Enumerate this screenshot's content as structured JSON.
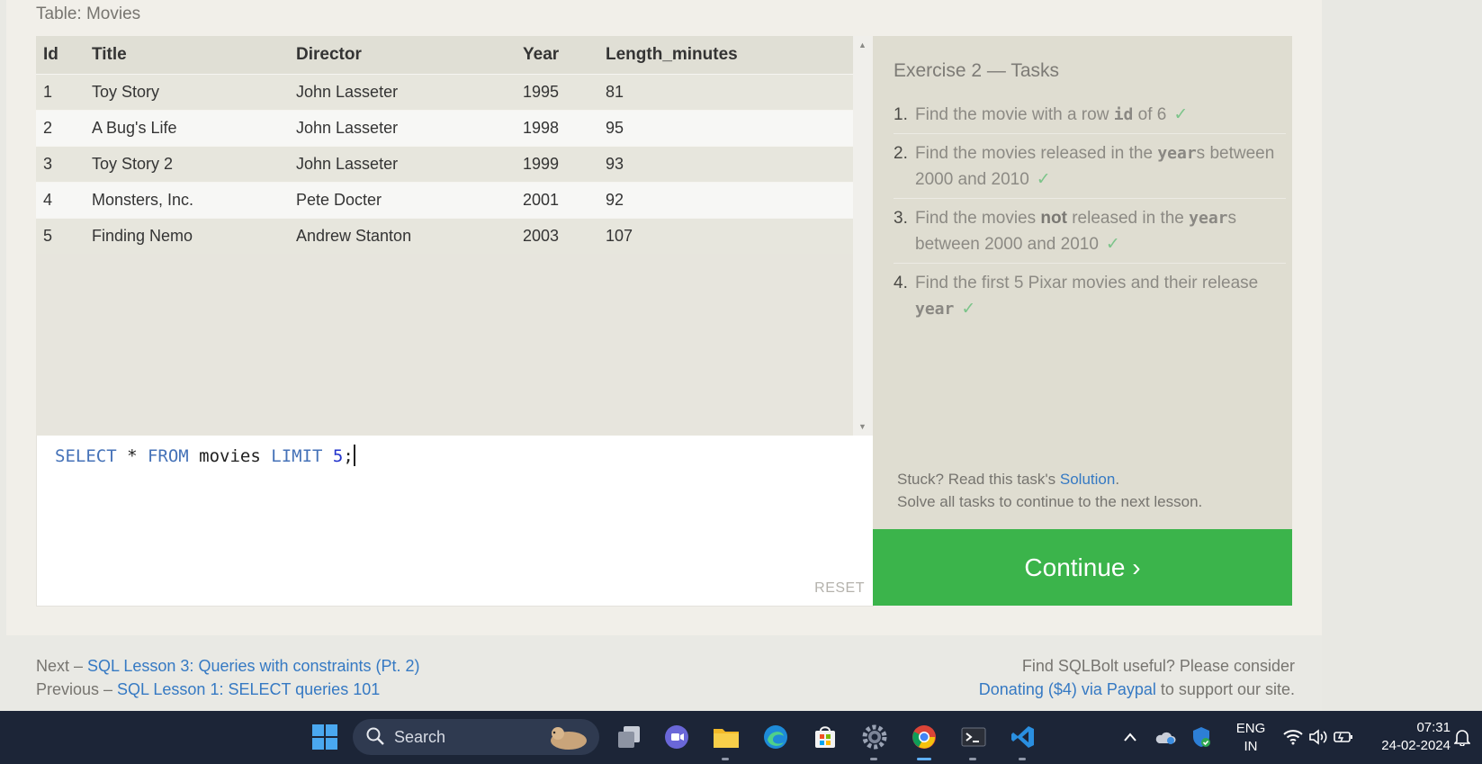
{
  "table_caption": "Table: Movies",
  "table": {
    "columns": [
      "Id",
      "Title",
      "Director",
      "Year",
      "Length_minutes"
    ],
    "rows": [
      [
        "1",
        "Toy Story",
        "John Lasseter",
        "1995",
        "81"
      ],
      [
        "2",
        "A Bug's Life",
        "John Lasseter",
        "1998",
        "95"
      ],
      [
        "3",
        "Toy Story 2",
        "John Lasseter",
        "1999",
        "93"
      ],
      [
        "4",
        "Monsters, Inc.",
        "Pete Docter",
        "2001",
        "92"
      ],
      [
        "5",
        "Finding Nemo",
        "Andrew Stanton",
        "2003",
        "107"
      ]
    ]
  },
  "editor": {
    "kw_select": "SELECT",
    "star": " * ",
    "kw_from": "FROM",
    "table": " movies ",
    "kw_limit": "LIMIT",
    "limit_value": " 5",
    "semicolon": ";",
    "reset_label": "RESET"
  },
  "tasks": {
    "title": "Exercise 2 — Tasks",
    "items": [
      {
        "num": "1.",
        "before": "Find the movie with a row ",
        "code": "id",
        "after": " of 6",
        "check": "✓"
      },
      {
        "num": "2.",
        "before": "Find the movies released in the ",
        "code": "year",
        "after": "s between 2000 and 2010",
        "check": "✓"
      },
      {
        "num": "3.",
        "before": "Find the movies ",
        "strong": "not",
        "middle": " released in the ",
        "code": "year",
        "after": "s between 2000 and 2010",
        "check": "✓"
      },
      {
        "num": "4.",
        "before": "Find the first 5 Pixar movies and their release ",
        "code": "year",
        "check": "✓"
      }
    ],
    "stuck_prefix": "Stuck? Read this task's ",
    "solution_link": "Solution",
    "stuck_suffix": ".",
    "solve_all": "Solve all tasks to continue to the next lesson.",
    "continue_label": "Continue ›"
  },
  "footer": {
    "next_prefix": "Next – ",
    "next_link": "SQL Lesson 3: Queries with constraints (Pt. 2)",
    "prev_prefix": "Previous – ",
    "prev_link": "SQL Lesson 1: SELECT queries 101",
    "useful_text": "Find SQLBolt useful? Please consider",
    "donate_link": "Donating ($4) via Paypal",
    "support_text": " to support our site."
  },
  "taskbar": {
    "search_label": "Search",
    "lang_top": "ENG",
    "lang_bottom": "IN",
    "time": "07:31",
    "date": "24-02-2024",
    "icons": [
      "windows-start-icon",
      "task-view-icon",
      "teams-chat-icon",
      "file-explorer-icon",
      "edge-icon",
      "store-icon",
      "settings-icon",
      "chrome-icon",
      "terminal-icon",
      "vscode-icon"
    ]
  },
  "colors": {
    "continue": "#3bb44b",
    "link": "#3579c3",
    "taskbar": "#1c2537",
    "check": "#7cc48a"
  }
}
